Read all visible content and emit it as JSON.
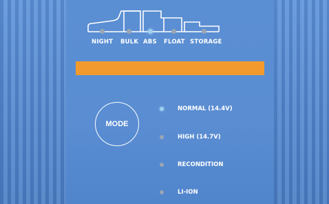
{
  "charge_stages": {
    "items": [
      {
        "label": "NIGHT",
        "active": false
      },
      {
        "label": "BULK",
        "active": false
      },
      {
        "label": "ABS",
        "active": true
      },
      {
        "label": "FLOAT",
        "active": false
      },
      {
        "label": "STORAGE",
        "active": false
      }
    ]
  },
  "display": {
    "bar_color": "#f39a2e"
  },
  "mode_button": {
    "label": "MODE"
  },
  "modes": {
    "items": [
      {
        "label": "NORMAL (14.4V)",
        "active": true
      },
      {
        "label": "HIGH (14.7V)",
        "active": false
      },
      {
        "label": "RECONDITION",
        "active": false
      },
      {
        "label": "LI-ION",
        "active": false
      }
    ]
  },
  "colors": {
    "panel": "#5a8dd2",
    "indicator_on": "#9fd0f0",
    "indicator_off": "#9aa6b4"
  }
}
